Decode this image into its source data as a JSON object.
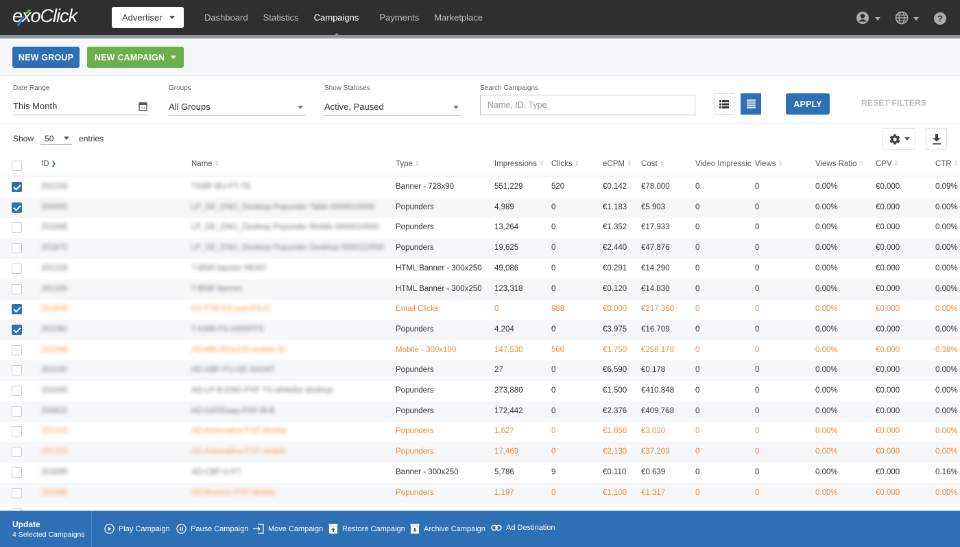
{
  "header": {
    "logo": "exoClick",
    "account_type": "Advertiser",
    "nav": [
      "Dashboard",
      "Statistics",
      "Campaigns",
      "Payments",
      "Marketplace"
    ],
    "active_nav": "Campaigns",
    "icons": [
      "user-icon",
      "globe-icon",
      "help-icon"
    ]
  },
  "actions": {
    "new_group": "NEW GROUP",
    "new_campaign": "NEW CAMPAIGN"
  },
  "filters": {
    "date_range_label": "Date Range",
    "date_range_value": "This Month",
    "groups_label": "Groups",
    "groups_value": "All Groups",
    "statuses_label": "Show Statuses",
    "statuses_value": "Active, Paused",
    "search_label": "Search Campaigns",
    "search_placeholder": "Name, ID, Type",
    "search_value": "",
    "apply": "APPLY",
    "reset": "RESET FILTERS"
  },
  "entries": {
    "show": "Show",
    "count": "50",
    "suffix": "entries"
  },
  "colors": {
    "primary": "#2f6fb5",
    "success": "#6ab04c",
    "paused_row": "#ef8a3e",
    "topbar": "#2f2f2f"
  },
  "table": {
    "columns": [
      "ID",
      "Name",
      "Type",
      "Impressions",
      "Clicks",
      "eCPM",
      "Cost",
      "Video Impressic",
      "Views",
      "Views Ratio",
      "CPV",
      "CTR"
    ],
    "sorted_column": "ID",
    "rows": [
      {
        "checked": true,
        "status": "active",
        "id": "201334",
        "name": "TXMF-BU-FT-T8",
        "type": "Banner - 728x90",
        "impressions": "551,229",
        "clicks": "520",
        "ecpm": "€0.142",
        "cost": "€78.000",
        "video_impressions": "0",
        "views": "0",
        "views_ratio": "0.00%",
        "cpv": "€0.000",
        "ctr": "0.09%"
      },
      {
        "checked": true,
        "status": "active",
        "id": "200000",
        "name": "LP_DE_ENG_Desktop Popunder Table 0000010000",
        "type": "Popunders",
        "impressions": "4,989",
        "clicks": "0",
        "ecpm": "€1.183",
        "cost": "€5.903",
        "video_impressions": "0",
        "views": "0",
        "views_ratio": "0.00%",
        "cpv": "€0.000",
        "ctr": "0.00%"
      },
      {
        "checked": false,
        "status": "active",
        "id": "201995",
        "name": "LP_DE_ENG_Desktop Popunder Mobile 0000010000",
        "type": "Popunders",
        "impressions": "13,264",
        "clicks": "0",
        "ecpm": "€1.352",
        "cost": "€17.933",
        "video_impressions": "0",
        "views": "0",
        "views_ratio": "0.00%",
        "cpv": "€0.000",
        "ctr": "0.00%"
      },
      {
        "checked": false,
        "status": "active",
        "id": "201870",
        "name": "LP_DE_ENG_Desktop Popunder Desktop 0000110000",
        "type": "Popunders",
        "impressions": "19,625",
        "clicks": "0",
        "ecpm": "€2.440",
        "cost": "€47.876",
        "video_impressions": "0",
        "views": "0",
        "views_ratio": "0.00%",
        "cpv": "€0.000",
        "ctr": "0.00%"
      },
      {
        "checked": false,
        "status": "active",
        "id": "201318",
        "name": "T-BNR banner HEAD",
        "type": "HTML Banner - 300x250",
        "impressions": "49,086",
        "clicks": "0",
        "ecpm": "€0.291",
        "cost": "€14.290",
        "video_impressions": "0",
        "views": "0",
        "views_ratio": "0.00%",
        "cpv": "€0.000",
        "ctr": "0.00%"
      },
      {
        "checked": false,
        "status": "active",
        "id": "201306",
        "name": "T-BNR banner",
        "type": "HTML Banner - 300x250",
        "impressions": "123,318",
        "clicks": "0",
        "ecpm": "€0.120",
        "cost": "€14.830",
        "video_impressions": "0",
        "views": "0",
        "views_ratio": "0.00%",
        "cpv": "€0.000",
        "ctr": "0.00%"
      },
      {
        "checked": true,
        "status": "paused",
        "id": "201608",
        "name": "EX-FTB-ES-pub-ES-D",
        "type": "Email Clicks",
        "impressions": "0",
        "clicks": "988",
        "ecpm": "€0.000",
        "cost": "€217.360",
        "video_impressions": "0",
        "views": "0",
        "views_ratio": "0.00%",
        "cpv": "€0.000",
        "ctr": "0.00%"
      },
      {
        "checked": true,
        "status": "active",
        "id": "201060",
        "name": "T-KMB-FS-0000PFS",
        "type": "Popunders",
        "impressions": "4,204",
        "clicks": "0",
        "ecpm": "€3.975",
        "cost": "€16.709",
        "video_impressions": "0",
        "views": "0",
        "views_ratio": "0.00%",
        "cpv": "€0.000",
        "ctr": "0.00%"
      },
      {
        "checked": false,
        "status": "paused",
        "id": "201098",
        "name": "AD-MB-300x100-mobile-M",
        "type": "Mobile - 300x100",
        "impressions": "147,530",
        "clicks": "560",
        "ecpm": "€1.750",
        "cost": "€258.178",
        "video_impressions": "0",
        "views": "0",
        "views_ratio": "0.00%",
        "cpv": "€0.000",
        "ctr": "0.38%"
      },
      {
        "checked": false,
        "status": "active",
        "id": "201030",
        "name": "AD-XBF-PU-DE-NX0AT",
        "type": "Popunders",
        "impressions": "27",
        "clicks": "0",
        "ecpm": "€6.590",
        "cost": "€0.178",
        "video_impressions": "0",
        "views": "0",
        "views_ratio": "0.00%",
        "cpv": "€0.000",
        "ctr": "0.00%"
      },
      {
        "checked": false,
        "status": "active",
        "id": "201000",
        "name": "AD-LP-B-ENG-PXF TX-whitelist desktop",
        "type": "Popunders",
        "impressions": "273,880",
        "clicks": "0",
        "ecpm": "€1.500",
        "cost": "€410.848",
        "video_impressions": "0",
        "views": "0",
        "views_ratio": "0.00%",
        "cpv": "€0.000",
        "ctr": "0.00%"
      },
      {
        "checked": false,
        "status": "active",
        "id": "200915",
        "name": "AD-GATEway-PXF-M-B",
        "type": "Popunders",
        "impressions": "172,442",
        "clicks": "0",
        "ecpm": "€2.376",
        "cost": "€409.768",
        "video_impressions": "0",
        "views": "0",
        "views_ratio": "0.00%",
        "cpv": "€0.000",
        "ctr": "0.00%"
      },
      {
        "checked": false,
        "status": "paused",
        "id": "201318",
        "name": "AD-Adrenaline-PXF-Mobile",
        "type": "Popunders",
        "impressions": "1,627",
        "clicks": "0",
        "ecpm": "€1.856",
        "cost": "€3.020",
        "video_impressions": "0",
        "views": "0",
        "views_ratio": "0.00%",
        "cpv": "€0.000",
        "ctr": "0.00%"
      },
      {
        "checked": false,
        "status": "paused",
        "id": "201310",
        "name": "AD-Adrenaline-PXF-Mobile",
        "type": "Popunders",
        "impressions": "17,469",
        "clicks": "0",
        "ecpm": "€2.130",
        "cost": "€37.209",
        "video_impressions": "0",
        "views": "0",
        "views_ratio": "0.00%",
        "cpv": "€0.000",
        "ctr": "0.00%"
      },
      {
        "checked": false,
        "status": "active",
        "id": "203089",
        "name": "AD-CBF-U-F7",
        "type": "Banner - 300x250",
        "impressions": "5,786",
        "clicks": "9",
        "ecpm": "€0.110",
        "cost": "€0.639",
        "video_impressions": "0",
        "views": "0",
        "views_ratio": "0.00%",
        "cpv": "€0.000",
        "ctr": "0.16%"
      },
      {
        "checked": false,
        "status": "paused",
        "id": "201088",
        "name": "AD-Bounce-PXF-Mobile",
        "type": "Popunders",
        "impressions": "1,197",
        "clicks": "0",
        "ecpm": "€1.100",
        "cost": "€1.317",
        "video_impressions": "0",
        "views": "0",
        "views_ratio": "0.00%",
        "cpv": "€0.000",
        "ctr": "0.00%"
      }
    ]
  },
  "bulk": {
    "title": "Update",
    "count_text": "4 Selected Campaigns",
    "actions": [
      "Play Campaign",
      "Pause Campaign",
      "Move Campaign",
      "Restore Campaign",
      "Archive Campaign",
      "Ad Destination"
    ]
  }
}
